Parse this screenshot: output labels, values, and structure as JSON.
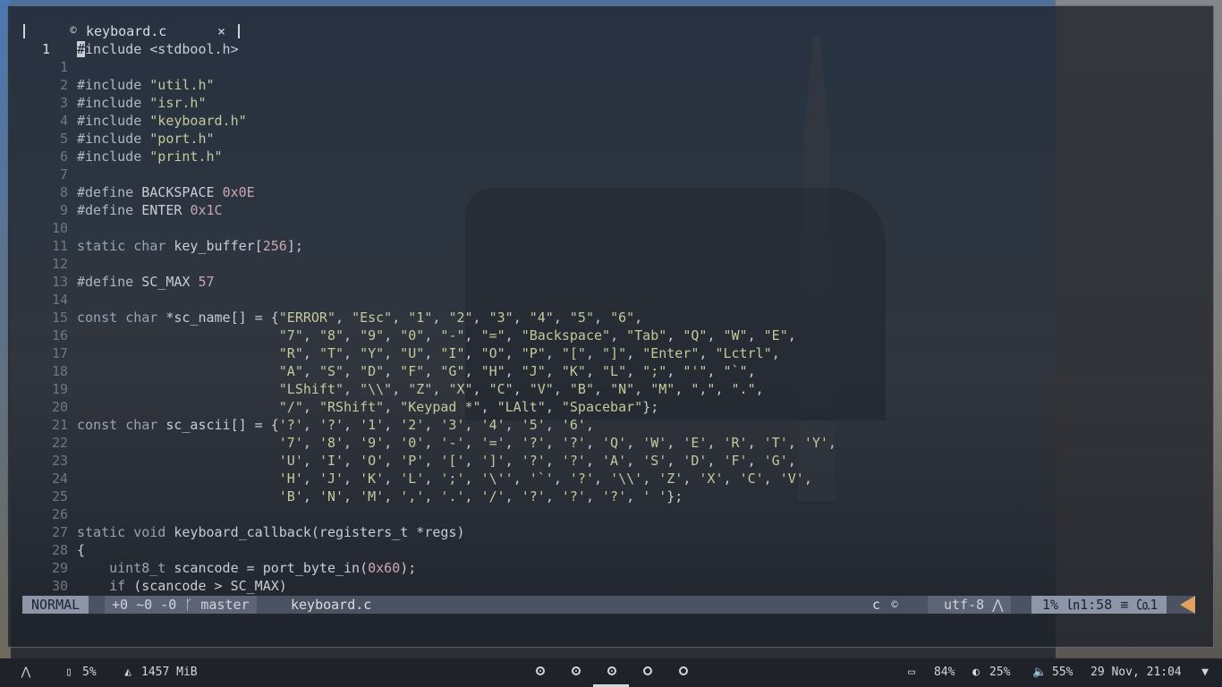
{
  "tab": {
    "filename": "keyboard.c",
    "file_icon": "c-language-icon",
    "close": "×"
  },
  "editor": {
    "current_line_number": "1",
    "lines": [
      {
        "n": "1",
        "t": "#include <stdbool.h>"
      },
      {
        "n": "1",
        "t": ""
      },
      {
        "n": "2",
        "t": "#include \"util.h\""
      },
      {
        "n": "3",
        "t": "#include \"isr.h\""
      },
      {
        "n": "4",
        "t": "#include \"keyboard.h\""
      },
      {
        "n": "5",
        "t": "#include \"port.h\""
      },
      {
        "n": "6",
        "t": "#include \"print.h\""
      },
      {
        "n": "7",
        "t": ""
      },
      {
        "n": "8",
        "t": "#define BACKSPACE 0x0E"
      },
      {
        "n": "9",
        "t": "#define ENTER 0x1C"
      },
      {
        "n": "10",
        "t": ""
      },
      {
        "n": "11",
        "t": "static char key_buffer[256];"
      },
      {
        "n": "12",
        "t": ""
      },
      {
        "n": "13",
        "t": "#define SC_MAX 57"
      },
      {
        "n": "14",
        "t": ""
      },
      {
        "n": "15",
        "t": "const char *sc_name[] = {\"ERROR\", \"Esc\", \"1\", \"2\", \"3\", \"4\", \"5\", \"6\","
      },
      {
        "n": "16",
        "t": "                         \"7\", \"8\", \"9\", \"0\", \"-\", \"=\", \"Backspace\", \"Tab\", \"Q\", \"W\", \"E\","
      },
      {
        "n": "17",
        "t": "                         \"R\", \"T\", \"Y\", \"U\", \"I\", \"O\", \"P\", \"[\", \"]\", \"Enter\", \"Lctrl\","
      },
      {
        "n": "18",
        "t": "                         \"A\", \"S\", \"D\", \"F\", \"G\", \"H\", \"J\", \"K\", \"L\", \";\", \"'\", \"`\","
      },
      {
        "n": "19",
        "t": "                         \"LShift\", \"\\\\\", \"Z\", \"X\", \"C\", \"V\", \"B\", \"N\", \"M\", \",\", \".\","
      },
      {
        "n": "20",
        "t": "                         \"/\", \"RShift\", \"Keypad *\", \"LAlt\", \"Spacebar\"};"
      },
      {
        "n": "21",
        "t": "const char sc_ascii[] = {'?', '?', '1', '2', '3', '4', '5', '6',"
      },
      {
        "n": "22",
        "t": "                         '7', '8', '9', '0', '-', '=', '?', '?', 'Q', 'W', 'E', 'R', 'T', 'Y',"
      },
      {
        "n": "23",
        "t": "                         'U', 'I', 'O', 'P', '[', ']', '?', '?', 'A', 'S', 'D', 'F', 'G',"
      },
      {
        "n": "24",
        "t": "                         'H', 'J', 'K', 'L', ';', '\\'', '`', '?', '\\\\', 'Z', 'X', 'C', 'V',"
      },
      {
        "n": "25",
        "t": "                         'B', 'N', 'M', ',', '.', '/', '?', '?', '?', ' '};"
      },
      {
        "n": "26",
        "t": ""
      },
      {
        "n": "27",
        "t": "static void keyboard_callback(registers_t *regs)"
      },
      {
        "n": "28",
        "t": "{"
      },
      {
        "n": "29",
        "t": "    uint8_t scancode = port_byte_in(0x60);"
      },
      {
        "n": "30",
        "t": "    if (scancode > SC_MAX)"
      }
    ]
  },
  "statusline": {
    "mode": "NORMAL",
    "git_diff": "+0 ~0 -0",
    "branch_icon": "git-branch-icon",
    "branch": "master",
    "filename": "keyboard.c",
    "filetype": "c",
    "filetype_icon": "c-language-icon",
    "encoding": "utf-8",
    "os_icon": "arch-linux-icon",
    "percent": "1%",
    "position": "1:58",
    "column": "1"
  },
  "taskbar": {
    "launcher_icon": "arch-linux-icon",
    "disk_icon": "disk-icon",
    "disk": "5%",
    "memory_icon": "memory-icon",
    "memory": "1457 MiB",
    "workspaces": [
      {
        "state": "occupied"
      },
      {
        "state": "occupied"
      },
      {
        "state": "active"
      },
      {
        "state": "empty"
      },
      {
        "state": "empty"
      }
    ],
    "battery_icon": "battery-icon",
    "battery": "84%",
    "brightness_icon": "brightness-icon",
    "brightness": "25%",
    "volume_icon": "volume-icon",
    "volume": "55%",
    "datetime": "29 Nov, 21:04",
    "wifi_icon": "wifi-icon"
  },
  "colors": {
    "mode_bg": "#8d96a8",
    "statusline_bg": "#4b5261",
    "accent_end": "#e0a060",
    "taskbar_bg": "#1f2229"
  }
}
